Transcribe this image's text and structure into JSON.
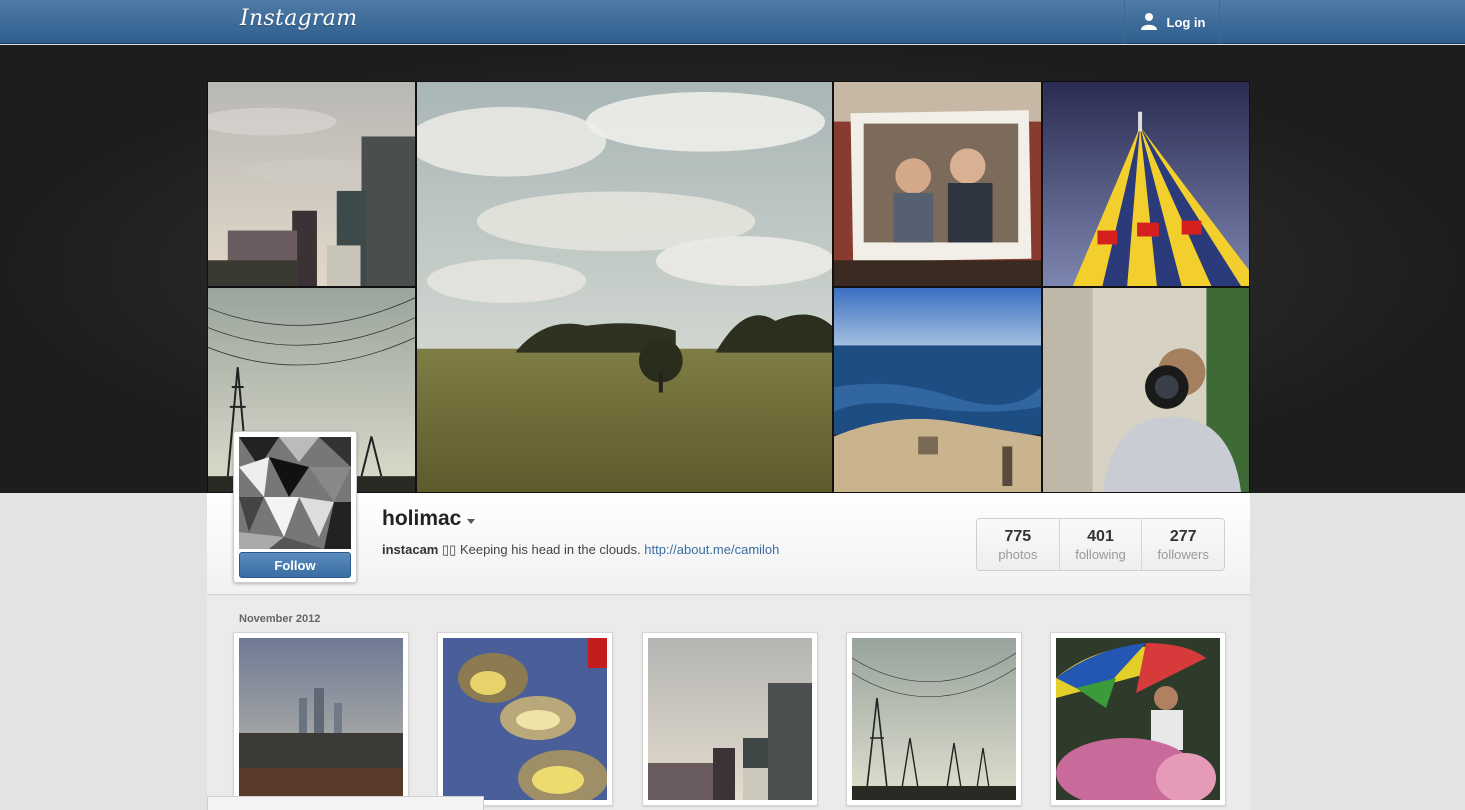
{
  "app": {
    "logo": "Instagram"
  },
  "header": {
    "login_label": "Log in"
  },
  "profile": {
    "username": "holimac",
    "bio_name": "instacam",
    "bio_glyphs": "▯▯",
    "bio_text": "Keeping his head in the clouds.",
    "bio_link": "http://about.me/camiloh",
    "follow_label": "Follow",
    "stats": [
      {
        "value": "775",
        "label": "photos"
      },
      {
        "value": "401",
        "label": "following"
      },
      {
        "value": "277",
        "label": "followers"
      }
    ]
  },
  "feed": {
    "month_label": "November 2012"
  },
  "icons": {
    "login": "user-icon",
    "dropdown": "caret-down-icon"
  },
  "colors": {
    "topbar": "#3a6a99",
    "link": "#3a6da3",
    "follow_button": "#4a7db3"
  }
}
